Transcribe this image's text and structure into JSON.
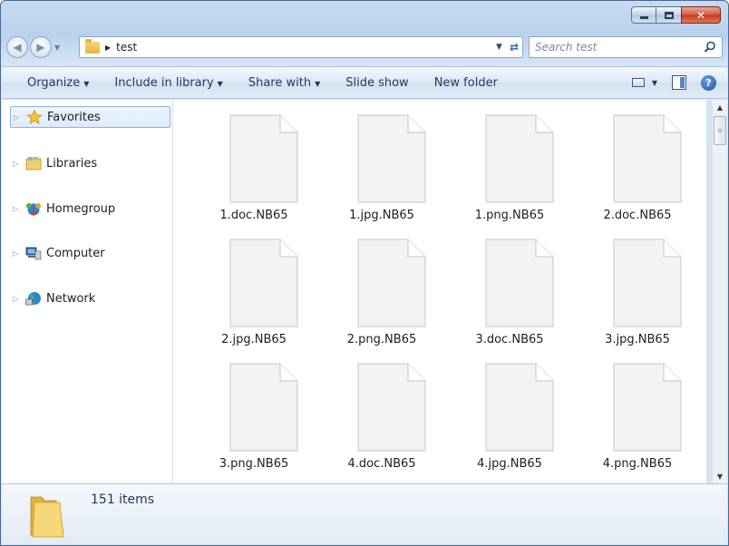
{
  "window": {
    "controls": {
      "minimize": "minimize",
      "maximize": "maximize",
      "close": "✕"
    }
  },
  "address": {
    "current_folder": "test",
    "search_placeholder": "Search test"
  },
  "toolbar": {
    "organize": "Organize",
    "include_in_library": "Include in library",
    "share_with": "Share with",
    "slide_show": "Slide show",
    "new_folder": "New folder",
    "help": "?"
  },
  "sidebar": {
    "items": [
      {
        "label": "Favorites",
        "icon": "star-icon",
        "selected": true
      },
      {
        "label": "Libraries",
        "icon": "libraries-icon",
        "selected": false
      },
      {
        "label": "Homegroup",
        "icon": "homegroup-icon",
        "selected": false
      },
      {
        "label": "Computer",
        "icon": "computer-icon",
        "selected": false
      },
      {
        "label": "Network",
        "icon": "network-icon",
        "selected": false
      }
    ]
  },
  "files": [
    "1.doc.NB65",
    "1.jpg.NB65",
    "1.png.NB65",
    "2.doc.NB65",
    "2.jpg.NB65",
    "2.png.NB65",
    "3.doc.NB65",
    "3.jpg.NB65",
    "3.png.NB65",
    "4.doc.NB65",
    "4.jpg.NB65",
    "4.png.NB65"
  ],
  "details": {
    "item_count": "151 items"
  }
}
